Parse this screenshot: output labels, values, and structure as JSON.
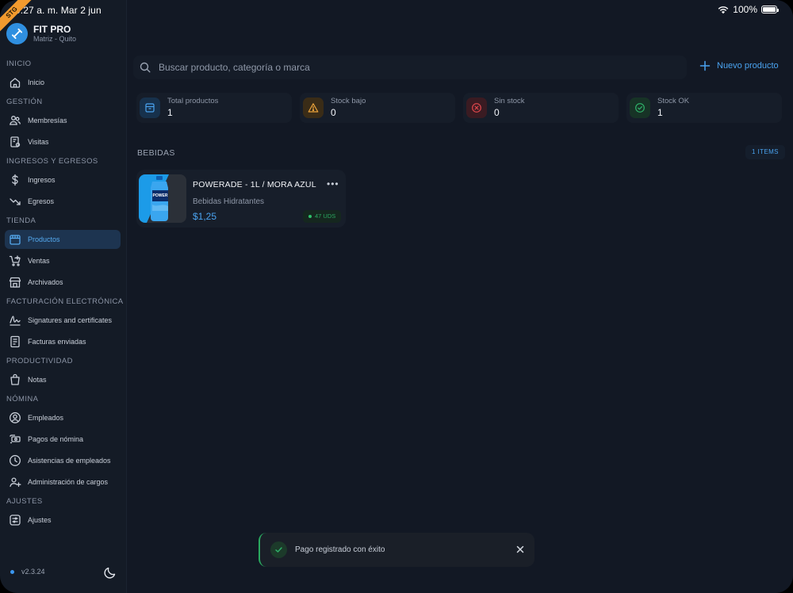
{
  "status_bar": {
    "time": "9:27 a. m.   Mar 2 jun",
    "battery": "100%"
  },
  "ribbon": "STG",
  "brand": {
    "name": "FIT PRO",
    "subtitle": "Matriz - Quito"
  },
  "sidebar": {
    "sections": [
      {
        "title": "INICIO",
        "items": [
          {
            "label": "Inicio",
            "icon": "home-icon"
          }
        ]
      },
      {
        "title": "GESTIÓN",
        "items": [
          {
            "label": "Membresías",
            "icon": "users-icon"
          },
          {
            "label": "Visitas",
            "icon": "visits-icon"
          }
        ]
      },
      {
        "title": "INGRESOS Y EGRESOS",
        "items": [
          {
            "label": "Ingresos",
            "icon": "dollar-icon"
          },
          {
            "label": "Egresos",
            "icon": "trend-down-icon"
          }
        ]
      },
      {
        "title": "TIENDA",
        "items": [
          {
            "label": "Productos",
            "icon": "store-icon",
            "active": true
          },
          {
            "label": "Ventas",
            "icon": "cart-icon"
          },
          {
            "label": "Archivados",
            "icon": "archive-store-icon"
          }
        ]
      },
      {
        "title": "FACTURACIÓN ELECTRÓNICA",
        "items": [
          {
            "label": "Signatures and certificates",
            "icon": "signature-icon"
          },
          {
            "label": "Facturas enviadas",
            "icon": "invoice-icon"
          }
        ]
      },
      {
        "title": "PRODUCTIVIDAD",
        "items": [
          {
            "label": "Notas",
            "icon": "notes-icon"
          }
        ]
      },
      {
        "title": "NÓMINA",
        "items": [
          {
            "label": "Empleados",
            "icon": "user-circle-icon"
          },
          {
            "label": "Pagos de nómina",
            "icon": "cash-icon"
          },
          {
            "label": "Asistencias de empleados",
            "icon": "clock-icon"
          },
          {
            "label": "Administración de cargos",
            "icon": "user-plus-icon"
          }
        ]
      },
      {
        "title": "AJUSTES",
        "items": [
          {
            "label": "Ajustes",
            "icon": "settings-icon"
          }
        ]
      }
    ],
    "version": "v2.3.24"
  },
  "search": {
    "placeholder": "Buscar producto, categoría o marca",
    "value": ""
  },
  "new_product_label": "Nuevo producto",
  "stats": [
    {
      "label": "Total productos",
      "value": "1",
      "icon": "box-icon",
      "color": "#4aa3f0"
    },
    {
      "label": "Stock bajo",
      "value": "0",
      "icon": "warning-icon",
      "color": "#e9a23b"
    },
    {
      "label": "Sin stock",
      "value": "0",
      "icon": "x-circle-icon",
      "color": "#e0474c"
    },
    {
      "label": "Stock OK",
      "value": "1",
      "icon": "check-circle-icon",
      "color": "#2fb36a"
    }
  ],
  "category": {
    "title": "BEBIDAS",
    "count_label": "1 ITEMS"
  },
  "products": [
    {
      "name": "POWERADE - 1L / MORA AZUL",
      "category": "Bebidas Hidratantes",
      "price": "$1,25",
      "stock": "47 UDS"
    }
  ],
  "toast": {
    "message": "Pago registrado con éxito"
  },
  "colors": {
    "accent": "#4aa3f0",
    "active_bg": "#1d3450",
    "success": "#2fb36a"
  }
}
